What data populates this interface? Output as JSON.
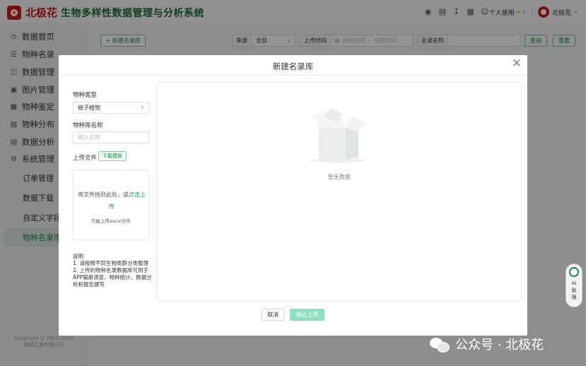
{
  "header": {
    "logo_text": "北极花",
    "app_title": "生物多样性数据管理与分析系统",
    "user_label": "个人使用",
    "user_badge": "",
    "account_name": "北极花"
  },
  "sidebar": {
    "items": [
      {
        "label": "数据首页",
        "icon": "home-icon"
      },
      {
        "label": "物种名录",
        "icon": "list-icon"
      },
      {
        "label": "数据管理",
        "icon": "database-icon"
      },
      {
        "label": "图片管理",
        "icon": "image-icon"
      },
      {
        "label": "物种鉴定",
        "icon": "identify-icon"
      },
      {
        "label": "物种分布",
        "icon": "map-icon"
      },
      {
        "label": "数据分析",
        "icon": "chart-icon"
      },
      {
        "label": "系统管理",
        "icon": "gear-icon"
      }
    ],
    "sub_items": [
      {
        "label": "订单管理"
      },
      {
        "label": "数据下载"
      },
      {
        "label": "自定义字段"
      },
      {
        "label": "物种名录库"
      }
    ],
    "copyright_1": "Copyright © 2011-2025",
    "copyright_2": "鹏程万里有限公司"
  },
  "toolbar": {
    "new_button": "+ 新建名录库",
    "source_label": "来源",
    "source_value": "全部",
    "upload_time_label": "上传时间",
    "start_placeholder": "开始时间",
    "separator": "-",
    "end_placeholder": "结束时间",
    "name_label": "名录名称",
    "search_button": "查询",
    "reset_button": "重置"
  },
  "modal": {
    "title": "新建名录库",
    "species_type_label": "物种类型",
    "species_type_value": "被子植物",
    "library_name_label": "物种库名称",
    "library_name_placeholder": "输入名称",
    "upload_label": "上传文件",
    "template_button": "下载模板",
    "dropzone_text": "将文件拖到此处，或",
    "dropzone_link": "点击上传",
    "dropzone_hint": "只能上传excel文件",
    "notes_title": "说明",
    "notes_1": "1. 请按照不同生物类群分类整理",
    "notes_2": "2. 上传的物种名录数据库可用于APP届册调查、物种统计、数据分析和报告撰写",
    "empty_text": "暂无数据",
    "cancel_button": "取消",
    "confirm_button": "确认上传"
  },
  "ai_assistant": {
    "label_1": "AI",
    "label_2": "助",
    "label_3": "理"
  },
  "watermark": {
    "text": "公众号 · 北极花"
  }
}
